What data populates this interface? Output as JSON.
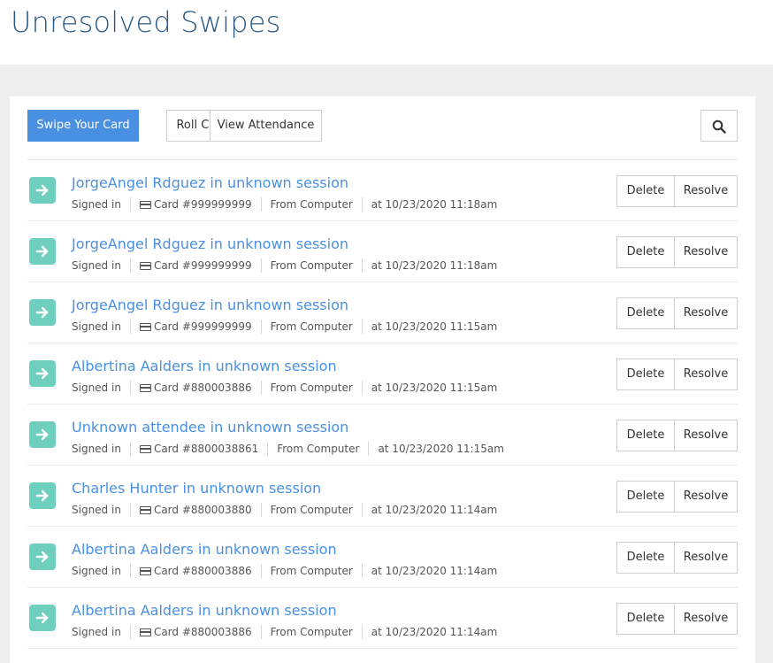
{
  "page": {
    "title": "Unresolved Swipes"
  },
  "toolbar": {
    "swipe_label": "Swipe Your Card",
    "roll_label": "Roll Call",
    "attendance_label": "View Attendance",
    "search_icon": "search-icon"
  },
  "colors": {
    "primary": "#4a90e2",
    "title": "#2c5a85",
    "badge": "#6fcfbe",
    "background": "#efefef"
  },
  "row_actions": {
    "delete_label": "Delete",
    "resolve_label": "Resolve"
  },
  "swipes": [
    {
      "title": "JorgeAngel Rdguez in unknown session",
      "status": "Signed in",
      "card": "Card #999999999",
      "source": "From Computer",
      "time": "at 10/23/2020 11:18am"
    },
    {
      "title": "JorgeAngel Rdguez in unknown session",
      "status": "Signed in",
      "card": "Card #999999999",
      "source": "From Computer",
      "time": "at 10/23/2020 11:18am"
    },
    {
      "title": "JorgeAngel Rdguez in unknown session",
      "status": "Signed in",
      "card": "Card #999999999",
      "source": "From Computer",
      "time": "at 10/23/2020 11:15am"
    },
    {
      "title": "Albertina Aalders in unknown session",
      "status": "Signed in",
      "card": "Card #880003886",
      "source": "From Computer",
      "time": "at 10/23/2020 11:15am"
    },
    {
      "title": "Unknown attendee in unknown session",
      "status": "Signed in",
      "card": "Card #8800038861",
      "source": "From Computer",
      "time": "at 10/23/2020 11:15am"
    },
    {
      "title": "Charles Hunter in unknown session",
      "status": "Signed in",
      "card": "Card #880003880",
      "source": "From Computer",
      "time": "at 10/23/2020 11:14am"
    },
    {
      "title": "Albertina Aalders in unknown session",
      "status": "Signed in",
      "card": "Card #880003886",
      "source": "From Computer",
      "time": "at 10/23/2020 11:14am"
    },
    {
      "title": "Albertina Aalders in unknown session",
      "status": "Signed in",
      "card": "Card #880003886",
      "source": "From Computer",
      "time": "at 10/23/2020 11:14am"
    }
  ]
}
